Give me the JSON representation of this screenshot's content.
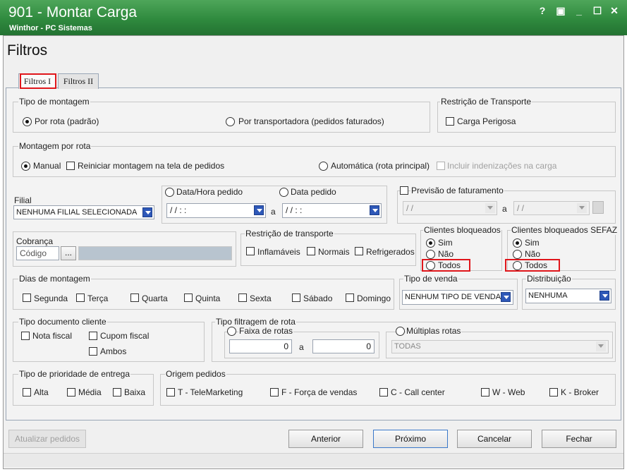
{
  "window": {
    "title": "901 - Montar Carga",
    "subtitle": "Winthor - PC Sistemas",
    "controls": [
      "?",
      "▣",
      "_",
      "☐",
      "✕"
    ]
  },
  "heading": "Filtros",
  "tabs": [
    "Filtros I",
    "Filtros II"
  ],
  "tipo_montagem": {
    "title": "Tipo de montagem",
    "opt1": "Por rota (padrão)",
    "opt2": "Por transportadora (pedidos faturados)"
  },
  "restricao_transporte1": {
    "title": "Restrição de Transporte",
    "carga_perigosa": "Carga Perigosa"
  },
  "montagem_rota": {
    "title": "Montagem por rota",
    "manual": "Manual",
    "reiniciar": "Reiniciar montagem na tela de pedidos",
    "automatica": "Automática (rota principal)",
    "incluir": "Incluir indenizações na carga"
  },
  "filial": {
    "label": "Filial",
    "value": "NENHUMA FILIAL SELECIONADA"
  },
  "data": {
    "opt1": "Data/Hora pedido",
    "opt2": "Data pedido",
    "from": "/ /   : :",
    "a": "a",
    "to": "/ /   : :"
  },
  "previsao": {
    "label": "Previsão de faturamento",
    "from": "/ /",
    "a": "a",
    "to": "/ /"
  },
  "cobranca": {
    "title": "Cobrança",
    "codigo": "Código",
    "btn": "..."
  },
  "restricao_transporte2": {
    "title": "Restrição de transporte",
    "inflamaveis": "Inflamáveis",
    "normais": "Normais",
    "refrigerados": "Refrigerados"
  },
  "clientes_bloq": {
    "title": "Clientes bloqueados",
    "sim": "Sim",
    "nao": "Não",
    "todos": "Todos"
  },
  "clientes_bloq_sefaz": {
    "title": "Clientes bloqueados SEFAZ",
    "sim": "Sim",
    "nao": "Não",
    "todos": "Todos"
  },
  "dias": {
    "title": "Dias de montagem",
    "items": [
      "Segunda",
      "Terça",
      "Quarta",
      "Quinta",
      "Sexta",
      "Sábado",
      "Domingo"
    ]
  },
  "tipo_venda": {
    "title": "Tipo de venda",
    "value": "NENHUM TIPO DE VENDA"
  },
  "distribuicao": {
    "title": "Distribuição",
    "value": "NENHUMA"
  },
  "tipo_doc": {
    "title": "Tipo documento cliente",
    "nota": "Nota fiscal",
    "cupom": "Cupom fiscal",
    "ambos": "Ambos"
  },
  "filtragem_rota": {
    "title": "Tipo filtragem de rota",
    "faixa": "Faixa de rotas",
    "from": "0",
    "a": "a",
    "to": "0",
    "multiplas": "Múltiplas rotas",
    "todas": "TODAS"
  },
  "prioridade": {
    "title": "Tipo de prioridade de  entrega",
    "alta": "Alta",
    "media": "Média",
    "baixa": "Baixa"
  },
  "origem": {
    "title": "Origem pedidos",
    "tele": "T - TeleMarketing",
    "forca": "F - Força de vendas",
    "call": "C - Call center",
    "web": "W - Web",
    "broker": "K - Broker"
  },
  "buttons": {
    "atualizar": "Atualizar pedidos",
    "anterior": "Anterior",
    "proximo": "Próximo",
    "cancelar": "Cancelar",
    "fechar": "Fechar"
  },
  "colors": {
    "title_green": "#2f8a3e",
    "highlight_red": "#e0161b",
    "dropdown_blue": "#2e58b8"
  }
}
